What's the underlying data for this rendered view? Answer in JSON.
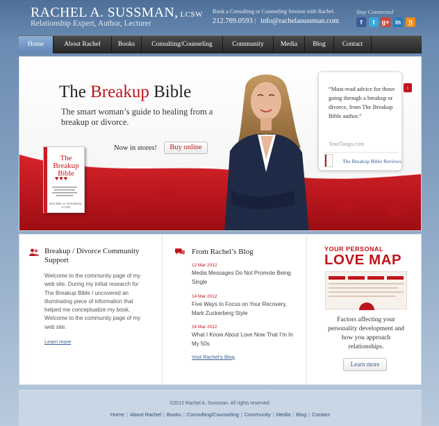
{
  "header": {
    "name": "RACHEL A. SUSSMAN,",
    "credential": "LCSW",
    "tagline": "Relationship Expert, Author, Lecturer",
    "booking_text": "Book a Consulting or Counseling Session with Rachel.",
    "phone": "212.769.0593",
    "separator": "|",
    "email": "info@rachelasussman.com",
    "stay_connected": "Stay Connected",
    "social": [
      {
        "name": "facebook-icon",
        "glyph": "f",
        "color": "#3b5b9a"
      },
      {
        "name": "twitter-icon",
        "glyph": "t",
        "color": "#3aa7dc"
      },
      {
        "name": "google-plus-icon",
        "glyph": "g+",
        "color": "#d04a37"
      },
      {
        "name": "linkedin-icon",
        "glyph": "in",
        "color": "#2c7ab3"
      },
      {
        "name": "rss-icon",
        "glyph": "))",
        "color": "#f08b1d"
      }
    ]
  },
  "nav": {
    "items": [
      {
        "label": "Home",
        "active": true
      },
      {
        "label": "About Rachel"
      },
      {
        "label": "Books"
      },
      {
        "label": "Consulting/Counseling"
      },
      {
        "label": "Community"
      },
      {
        "label": "Media"
      },
      {
        "label": "Blog"
      },
      {
        "label": "Contact"
      }
    ]
  },
  "hero": {
    "title_pre": "The ",
    "title_accent": "Breakup",
    "title_post": " Bible",
    "subtitle": "The smart woman’s guide to healing from a breakup or divorce.",
    "now_in_stores": "Now in stores!",
    "buy_button": "Buy online",
    "book": {
      "title_line1": "The",
      "title_line2": "Breakup",
      "title_line3": "Bible",
      "hearts": "♥♥♥",
      "author": "RACHEL A. SUSSMAN, LCSW"
    },
    "quote": {
      "text": "“Must-read advice for those going through a breakup or divorce, from The Breakup Bible author.”",
      "source": "YourTango.com",
      "reviews_link": "The Breakup Bible Reviews",
      "next_glyph": "›"
    }
  },
  "community": {
    "title": "Breakup / Divorce Community Support",
    "body": "Welcome to the community page of my web site. During my initial research for The Breakup Bible I uncovered an illuminating piece of information that helped me conceptualize my book. Welcome to the community page of my web site.",
    "learn_more": "Learn more"
  },
  "blog": {
    "title": "From Rachel’s Blog",
    "posts": [
      {
        "date": "12 Mar 2012",
        "title": "Media Messages Do Not Promote Being Single"
      },
      {
        "date": "14 Mar 2012",
        "title": "Five Ways to Focus on Your Recovery, Mark Zuckerberg Style"
      },
      {
        "date": "16 Mar 2012",
        "title": "What I Know About Love Now That I’m In My 50s"
      }
    ],
    "visit_link": "Visit Rachel’s Blog"
  },
  "love_map": {
    "your_personal": "YOUR PERSONAL",
    "title": "LOVE MAP",
    "description": "Factors affecting your personality development and how you approach relationships.",
    "learn_more": "Learn more"
  },
  "footer": {
    "copyright": "©2012 Rachel A. Sussman. All rights reserved.",
    "links": [
      "Home",
      "About Rachel",
      "Books",
      "Consulting/Counseling",
      "Community",
      "Media",
      "Blog",
      "Contact"
    ],
    "separator": "|"
  },
  "colors": {
    "accent_red": "#c0141c",
    "nav_dark": "#2b2b2b",
    "nav_active": "#6f93c0",
    "link_blue": "#3a5e91",
    "page_blue": "#5f80a8"
  }
}
